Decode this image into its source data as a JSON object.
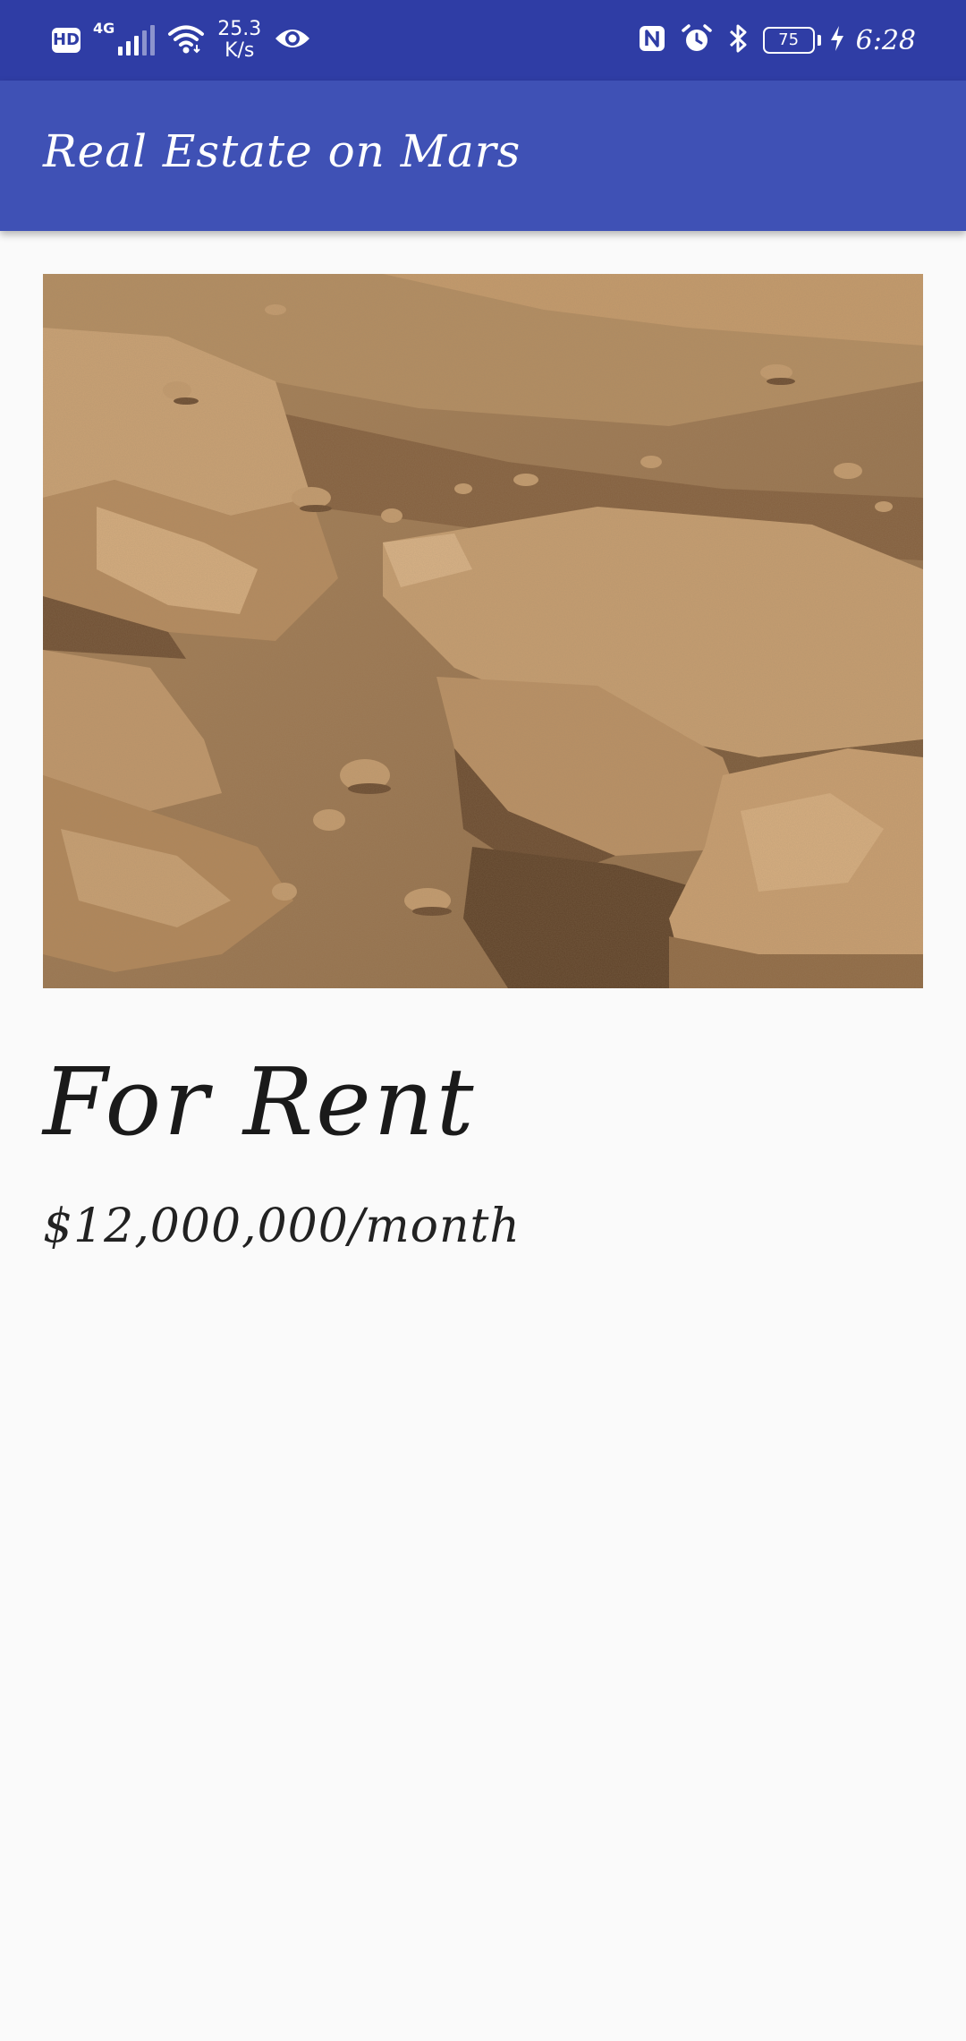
{
  "status_bar": {
    "background": "#2f3da5",
    "hd_label": "HD",
    "network_type": "4G",
    "speed_value": "25.3",
    "speed_unit": "K/s",
    "battery_level": "75",
    "time": "6:28",
    "icons": [
      "hd-icon",
      "signal-icon",
      "wifi-icon",
      "eye-icon",
      "nfc-icon",
      "alarm-icon",
      "bluetooth-icon",
      "battery-icon",
      "charging-icon"
    ]
  },
  "app_bar": {
    "title": "Real Estate on Mars",
    "background": "#3f51b5"
  },
  "listing": {
    "type": "For Rent",
    "price": "$12,000,000/month"
  }
}
